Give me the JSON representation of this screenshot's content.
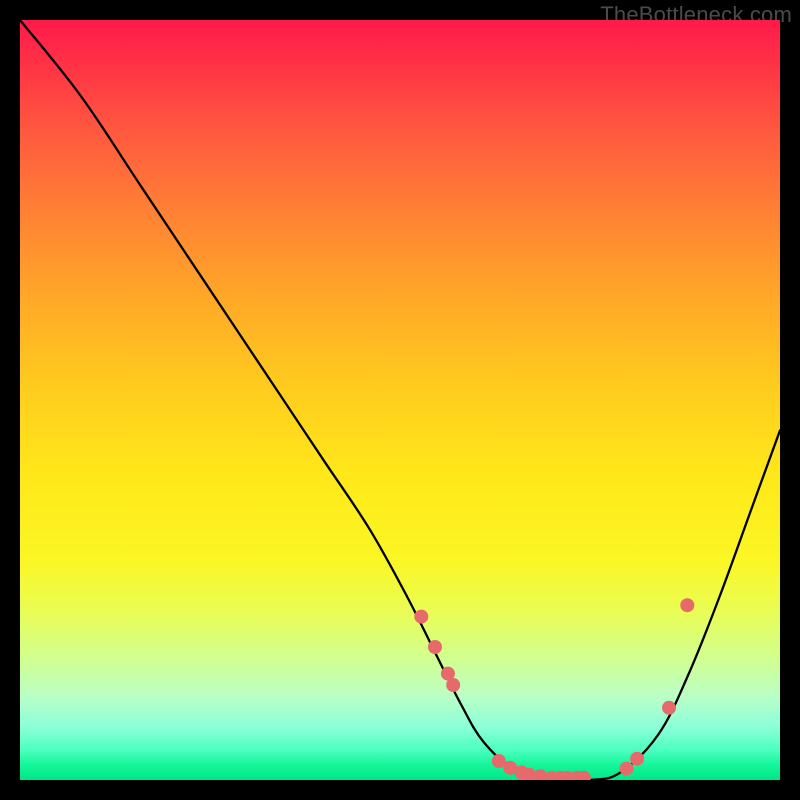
{
  "watermark": "TheBottleneck.com",
  "chart_data": {
    "type": "line",
    "title": "",
    "xlabel": "",
    "ylabel": "",
    "xlim": [
      0,
      100
    ],
    "ylim": [
      0,
      100
    ],
    "grid": false,
    "legend": false,
    "series": [
      {
        "name": "curve",
        "color": "#000000",
        "x": [
          0,
          8,
          16,
          22,
          28,
          34,
          40,
          46,
          51,
          55,
          58,
          61,
          65,
          70,
          75,
          79,
          84,
          88,
          92,
          96,
          100
        ],
        "values": [
          100,
          90,
          78,
          69,
          60,
          51,
          42,
          33,
          24,
          16,
          10,
          5,
          1.5,
          0,
          0,
          1,
          6,
          14,
          24,
          35,
          46
        ]
      }
    ],
    "markers": {
      "name": "highlight-dots",
      "color": "#e66a6a",
      "radius_px": 7,
      "points": [
        {
          "x": 52.8,
          "y": 21.5
        },
        {
          "x": 54.6,
          "y": 17.5
        },
        {
          "x": 56.3,
          "y": 14.0
        },
        {
          "x": 57.0,
          "y": 12.5
        },
        {
          "x": 63.0,
          "y": 2.5
        },
        {
          "x": 64.5,
          "y": 1.6
        },
        {
          "x": 66.0,
          "y": 1.0
        },
        {
          "x": 67.0,
          "y": 0.7
        },
        {
          "x": 68.5,
          "y": 0.5
        },
        {
          "x": 70.0,
          "y": 0.3
        },
        {
          "x": 71.0,
          "y": 0.3
        },
        {
          "x": 72.0,
          "y": 0.3
        },
        {
          "x": 73.3,
          "y": 0.3
        },
        {
          "x": 74.2,
          "y": 0.3
        },
        {
          "x": 79.8,
          "y": 1.5
        },
        {
          "x": 81.2,
          "y": 2.8
        },
        {
          "x": 85.4,
          "y": 9.5
        },
        {
          "x": 87.8,
          "y": 23.0
        }
      ]
    }
  }
}
